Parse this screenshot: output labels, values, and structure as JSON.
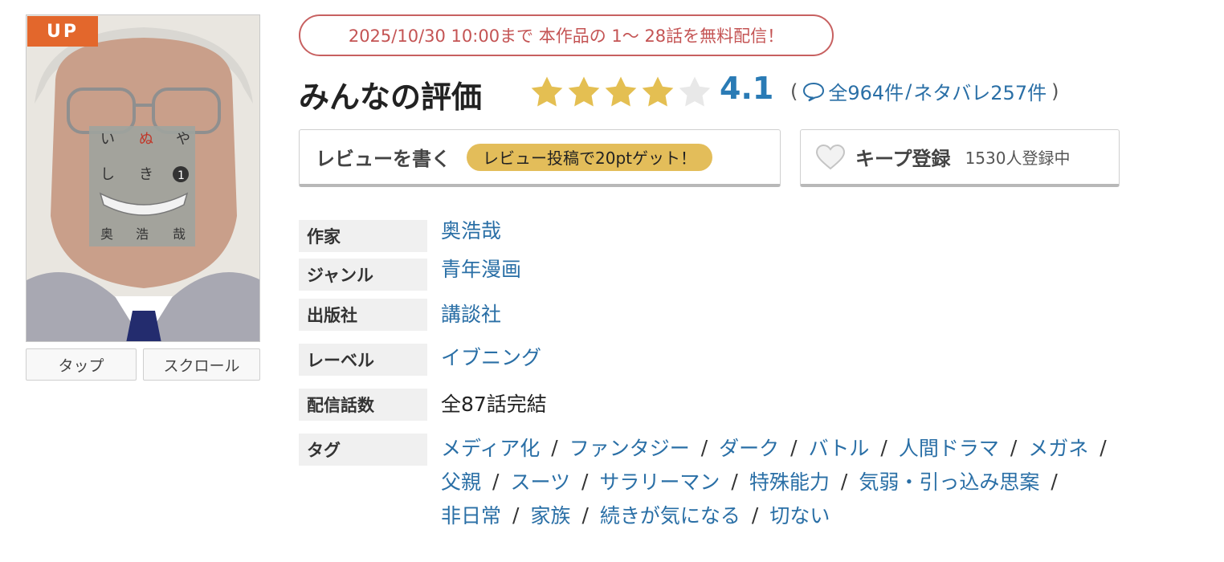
{
  "cover": {
    "badge": "UP",
    "title_chars": [
      "い",
      "ぬ",
      "や",
      "し",
      "き"
    ],
    "volume_number": "1",
    "author_chars": [
      "奥",
      "浩",
      "哉"
    ]
  },
  "viewer_buttons": {
    "tap": "タップ",
    "scroll": "スクロール"
  },
  "free_notice": "2025/10/30 10:00まで 本作品の 1〜 28話を無料配信！",
  "rating": {
    "title": "みんなの評価",
    "score": "4.1",
    "stars_filled": 4,
    "stars_total": 5,
    "open_paren": "(",
    "close_paren": ")",
    "reviews_all": "全964件",
    "separator": "/",
    "reviews_spoiler": "ネタバレ257件",
    "star_color": "#e4bf52",
    "star_empty_color": "#e8e8e8"
  },
  "review_button": {
    "label": "レビューを書く",
    "promo": "レビュー投稿で20ptゲット！"
  },
  "keep_button": {
    "label": "キープ登録",
    "count": "1530人登録中"
  },
  "info": {
    "author": {
      "label": "作家",
      "value": "奥浩哉"
    },
    "genre": {
      "label": "ジャンル",
      "value": "青年漫画"
    },
    "publisher": {
      "label": "出版社",
      "value": "講談社"
    },
    "imprint": {
      "label": "レーベル",
      "value": "イブニング"
    },
    "episodes": {
      "label": "配信話数",
      "value": "全87話完結"
    },
    "tags": {
      "label": "タグ",
      "separator": "/",
      "lines": [
        [
          "メディア化",
          "ファンタジー",
          "ダーク",
          "バトル",
          "人間ドラマ",
          "メガネ"
        ],
        [
          "父親",
          "スーツ",
          "サラリーマン",
          "特殊能力",
          "気弱・引っ込み思案"
        ],
        [
          "非日常",
          "家族",
          "続きが気になる",
          "切ない"
        ]
      ]
    }
  },
  "colors": {
    "link": "#2a6fa6",
    "score": "#2a7bb5",
    "badge": "#e3672c",
    "notice_border": "#c76060",
    "promo_pill": "#e3bd5a"
  }
}
